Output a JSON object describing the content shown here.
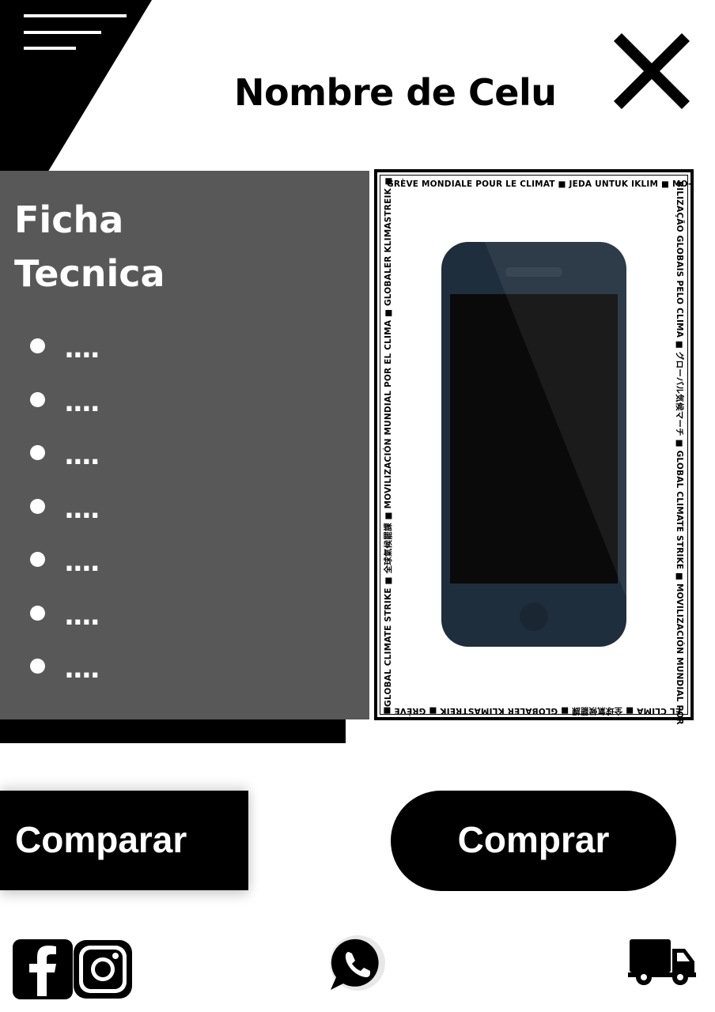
{
  "header": {
    "title": "Nombre de Celu",
    "menu_icon": "hamburger-menu-icon",
    "close_icon": "close-x-icon"
  },
  "specs": {
    "title_line1": "Ficha",
    "title_line2": "Tecnica",
    "items": [
      "....",
      "....",
      "....",
      "....",
      "....",
      "....",
      "...."
    ]
  },
  "product_image": {
    "icon": "smartphone-image",
    "border_top": "GRÈVE MONDIALE POUR LE CLIMAT ■ JEDA UNTUK IKLIM ■ MO-",
    "border_right": "BILIZAÇÃO GLOBAIS PELO CLIMA ■ グローバル気候マーチ ■ GLOBAL CLIMATE STRIKE ■ MOVILIZACIÓN MUNDIAL POR",
    "border_bottom": "EL CLIMA ■ 全球氣候罷課 ■ GLOBALER KLIMASTREIK ■ GRÈVE ■",
    "border_left": "GLOBAL CLIMATE STRIKE ■ 全球氣候罷課 ■ MOVILIZACIÓN MUNDIAL POR EL CLIMA ■ GLOBALER KLIMASTREIK ■"
  },
  "actions": {
    "compare_label": "Comparar",
    "buy_label": "Comprar"
  },
  "footer": {
    "icons": [
      "facebook-icon",
      "instagram-icon",
      "whatsapp-icon",
      "delivery-truck-icon"
    ]
  },
  "colors": {
    "primary": "#000000",
    "panel": "#585858",
    "background": "#ffffff",
    "phone_body": "#1e2d3c"
  }
}
